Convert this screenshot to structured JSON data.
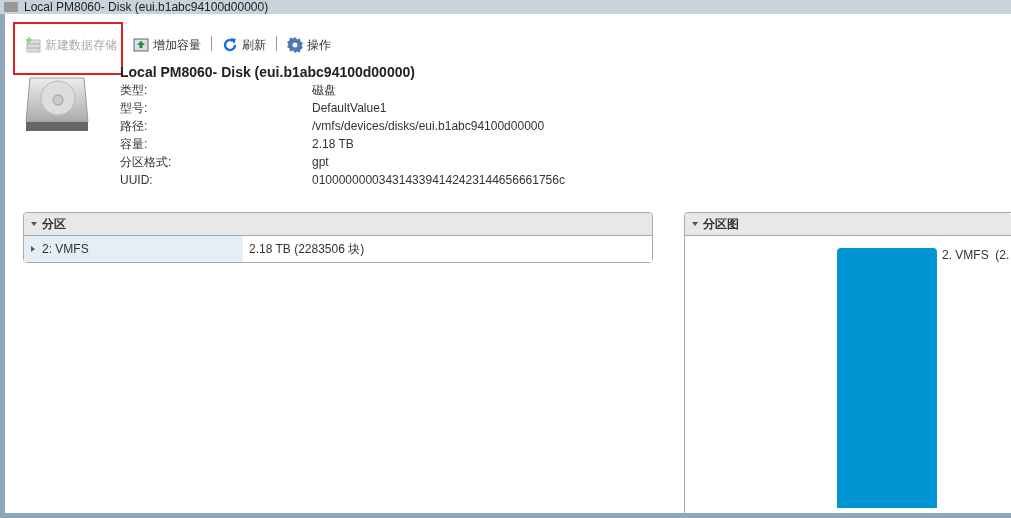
{
  "window": {
    "title": "Local PM8060- Disk (eui.b1abc94100d00000)"
  },
  "toolbar": [
    {
      "kind": "new",
      "label": "新建数据存储",
      "disabled": true,
      "highlighted": true
    },
    {
      "kind": "grow",
      "label": "增加容量",
      "disabled": false,
      "highlighted": false
    },
    {
      "kind": "refresh",
      "label": "刷新",
      "disabled": false,
      "highlighted": false
    },
    {
      "kind": "actions",
      "label": "操作",
      "disabled": false,
      "highlighted": false
    }
  ],
  "disk": {
    "name": "Local PM8060- Disk (eui.b1abc94100d00000)",
    "properties": [
      {
        "label": "类型:",
        "value": "磁盘"
      },
      {
        "label": "型号:",
        "value": "DefaultValue1"
      },
      {
        "label": "路径:",
        "value": "/vmfs/devices/disks/eui.b1abc94100d00000"
      },
      {
        "label": "容量:",
        "value": "2.18 TB"
      },
      {
        "label": "分区格式:",
        "value": "gpt"
      },
      {
        "label": "UUID:",
        "value": "0100000000343143394142423144656661756c"
      }
    ]
  },
  "partitions": {
    "title": "分区",
    "expanded": true,
    "rows": [
      {
        "name": "2: VMFS",
        "size": "2.18 TB (2283506 块)",
        "expanded": false
      }
    ]
  },
  "partition_map": {
    "title": "分区图",
    "expanded": true,
    "segments": [
      {
        "label": "2. VMFS  (2.",
        "color": "#0095d3"
      }
    ]
  }
}
